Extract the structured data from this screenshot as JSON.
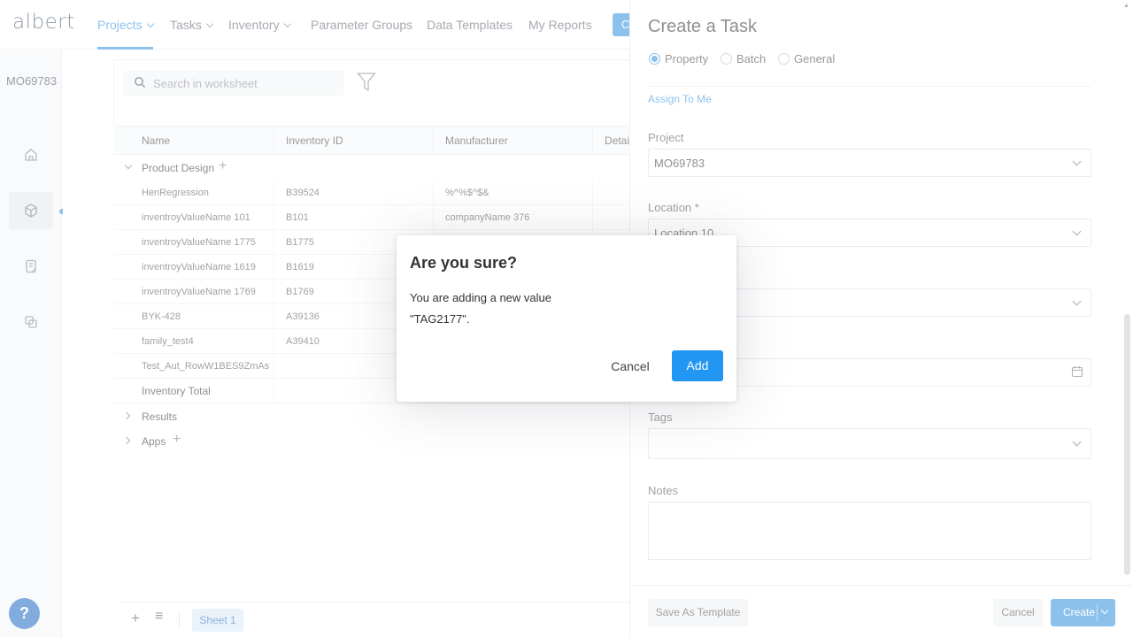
{
  "app": {
    "logo": "albert"
  },
  "nav": {
    "items": [
      {
        "label": "Projects",
        "active": true,
        "dropdown": true
      },
      {
        "label": "Tasks",
        "active": false,
        "dropdown": true
      },
      {
        "label": "Inventory",
        "active": false,
        "dropdown": true
      },
      {
        "label": "Parameter Groups",
        "active": false,
        "dropdown": false
      },
      {
        "label": "Data Templates",
        "active": false,
        "dropdown": false
      },
      {
        "label": "My Reports",
        "active": false,
        "dropdown": false
      }
    ],
    "create_button_glyph": "C"
  },
  "rail": {
    "project_id": "MO69783",
    "icons": [
      "home-icon",
      "cube-icon",
      "notebook-icon",
      "copy-icon"
    ],
    "help_label": "?"
  },
  "worksheet": {
    "search_placeholder": "Search in worksheet",
    "columns": [
      "Name",
      "Inventory ID",
      "Manufacturer",
      "Detail"
    ],
    "group": "Product Design",
    "rows": [
      {
        "name": "HenRegression",
        "id": "B39524",
        "manufacturer": "%^%$^$&"
      },
      {
        "name": "inventroyValueName 101",
        "id": "B101",
        "manufacturer": "companyName 376"
      },
      {
        "name": "inventroyValueName 1775",
        "id": "B1775",
        "manufacturer": ""
      },
      {
        "name": "inventroyValueName 1619",
        "id": "B1619",
        "manufacturer": ""
      },
      {
        "name": "inventroyValueName 1769",
        "id": "B1769",
        "manufacturer": ""
      },
      {
        "name": "BYK-428",
        "id": "A39136",
        "manufacturer": ""
      },
      {
        "name": "family_test4",
        "id": "A39410",
        "manufacturer": ""
      },
      {
        "name": "Test_Aut_RowW1BES9ZmAs",
        "id": "",
        "manufacturer": ""
      }
    ],
    "total_label": "Inventory Total",
    "sections": [
      "Results",
      "Apps"
    ],
    "sheet_tab": "Sheet 1"
  },
  "panel": {
    "title": "Create a Task",
    "task_types": [
      {
        "label": "Property",
        "checked": true
      },
      {
        "label": "Batch",
        "checked": false
      },
      {
        "label": "General",
        "checked": false
      }
    ],
    "assign_link": "Assign To Me",
    "project_label": "Project",
    "project_value": "MO69783",
    "location_label": "Location *",
    "location_value": "Location 10",
    "tags_label": "Tags",
    "notes_label": "Notes",
    "save_template": "Save As Template",
    "cancel": "Cancel",
    "create": "Create"
  },
  "modal": {
    "title": "Are you sure?",
    "message": "You are adding a new value",
    "value": "\"TAG2177\".",
    "cancel": "Cancel",
    "confirm": "Add"
  },
  "colors": {
    "accent": "#2f8fdd",
    "modal_button": "#2196f3",
    "help": "#1c67c4"
  }
}
